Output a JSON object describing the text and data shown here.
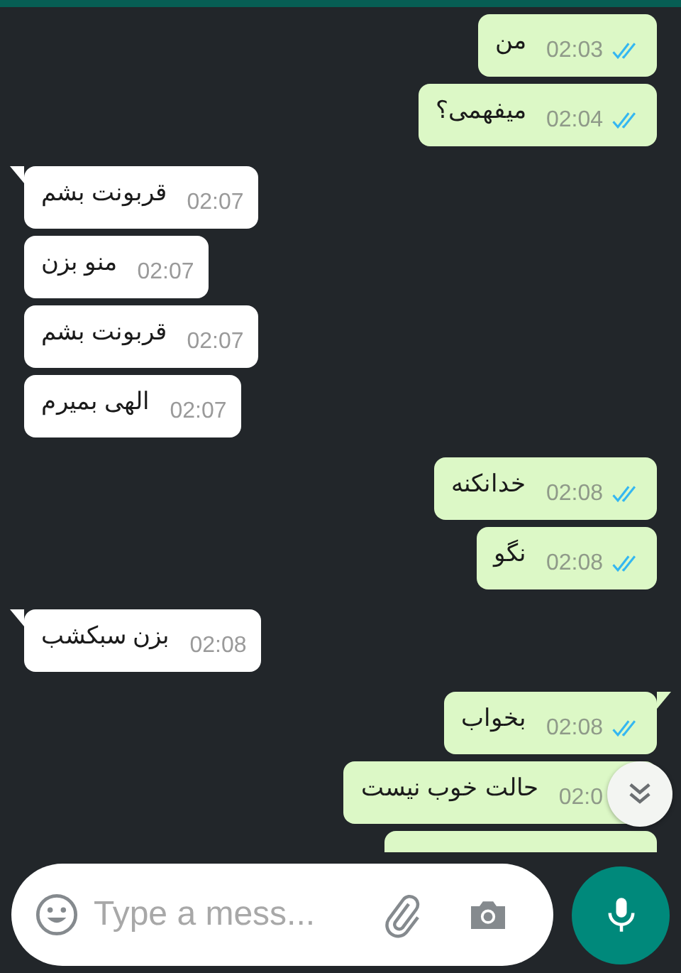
{
  "messages": [
    {
      "kind": "sent",
      "tail": false,
      "text": "من",
      "time": "02:03",
      "read": true
    },
    {
      "kind": "sent",
      "tail": false,
      "text": "میفهمی؟",
      "time": "02:04",
      "read": true
    },
    {
      "kind": "received",
      "tail": true,
      "text": "قربونت بشم",
      "time": "02:07"
    },
    {
      "kind": "received",
      "tail": false,
      "text": "منو بزن",
      "time": "02:07"
    },
    {
      "kind": "received",
      "tail": false,
      "text": "قربونت بشم",
      "time": "02:07"
    },
    {
      "kind": "received",
      "tail": false,
      "text": "الهی بمیرم",
      "time": "02:07"
    },
    {
      "kind": "sent",
      "tail": false,
      "text": "خدانکنه",
      "time": "02:08",
      "read": true
    },
    {
      "kind": "sent",
      "tail": false,
      "text": "نگو",
      "time": "02:08",
      "read": true
    },
    {
      "kind": "received",
      "tail": true,
      "text": "بزن سبکشب",
      "time": "02:08"
    },
    {
      "kind": "sent",
      "tail": true,
      "text": "بخواب",
      "time": "02:08",
      "read": true
    },
    {
      "kind": "sent",
      "tail": false,
      "text": "حالت خوب نیست",
      "time": "02:0"
    }
  ],
  "composer": {
    "placeholder": "Type a mess..."
  }
}
